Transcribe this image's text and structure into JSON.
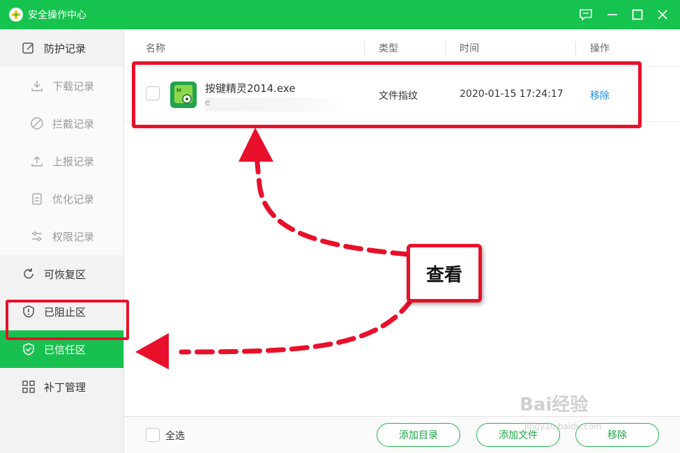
{
  "titlebar": {
    "title": "安全操作中心"
  },
  "sidebar": {
    "header": "防护记录",
    "sub_items": [
      "下载记录",
      "拦截记录",
      "上报记录",
      "优化记录",
      "权限记录"
    ],
    "items": [
      "可恢复区",
      "已阻止区",
      "已信任区",
      "补丁管理"
    ],
    "active": "已信任区"
  },
  "table": {
    "columns": [
      "名称",
      "类型",
      "时间",
      "操作"
    ],
    "rows": [
      {
        "name": "按键精灵2014.exe",
        "path": "e",
        "type": "文件指纹",
        "time": "2020-01-15 17:24:17",
        "action": "移除"
      }
    ]
  },
  "footer": {
    "select_all": "全选",
    "buttons": [
      "添加目录",
      "添加文件",
      "移除"
    ]
  },
  "annotation": {
    "label": "查看",
    "color": "#e8102a"
  },
  "watermark": {
    "text": "Bai经验",
    "sub": "jingyan.baidu.com"
  },
  "colors": {
    "brand": "#17c34f",
    "link": "#1b8df0"
  }
}
